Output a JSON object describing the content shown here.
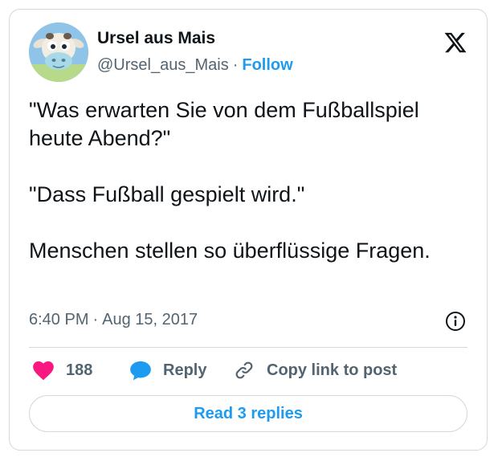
{
  "author": {
    "display_name": "Ursel aus Mais",
    "handle": "@Ursel_aus_Mais",
    "separator": "·",
    "follow_label": "Follow",
    "avatar_icon": "cartoon-cow-avatar"
  },
  "brand": {
    "logo_icon": "x-logo-icon"
  },
  "tweet": {
    "paragraphs": [
      "\"Was erwarten Sie von dem Fußballspiel heute Abend?\"",
      "\"Dass Fußball gespielt wird.\"",
      "Menschen stellen so überflüssige Fragen."
    ],
    "time": "6:40 PM",
    "separator": "·",
    "date": "Aug 15, 2017"
  },
  "actions": {
    "like_count": "188",
    "reply_label": "Reply",
    "copy_label": "Copy link to post"
  },
  "footer": {
    "read_replies_label": "Read 3 replies"
  },
  "colors": {
    "accent": "#1d9bf0",
    "like": "#f91880",
    "text": "#0f1419",
    "muted": "#536471",
    "border": "#cfd9de"
  }
}
